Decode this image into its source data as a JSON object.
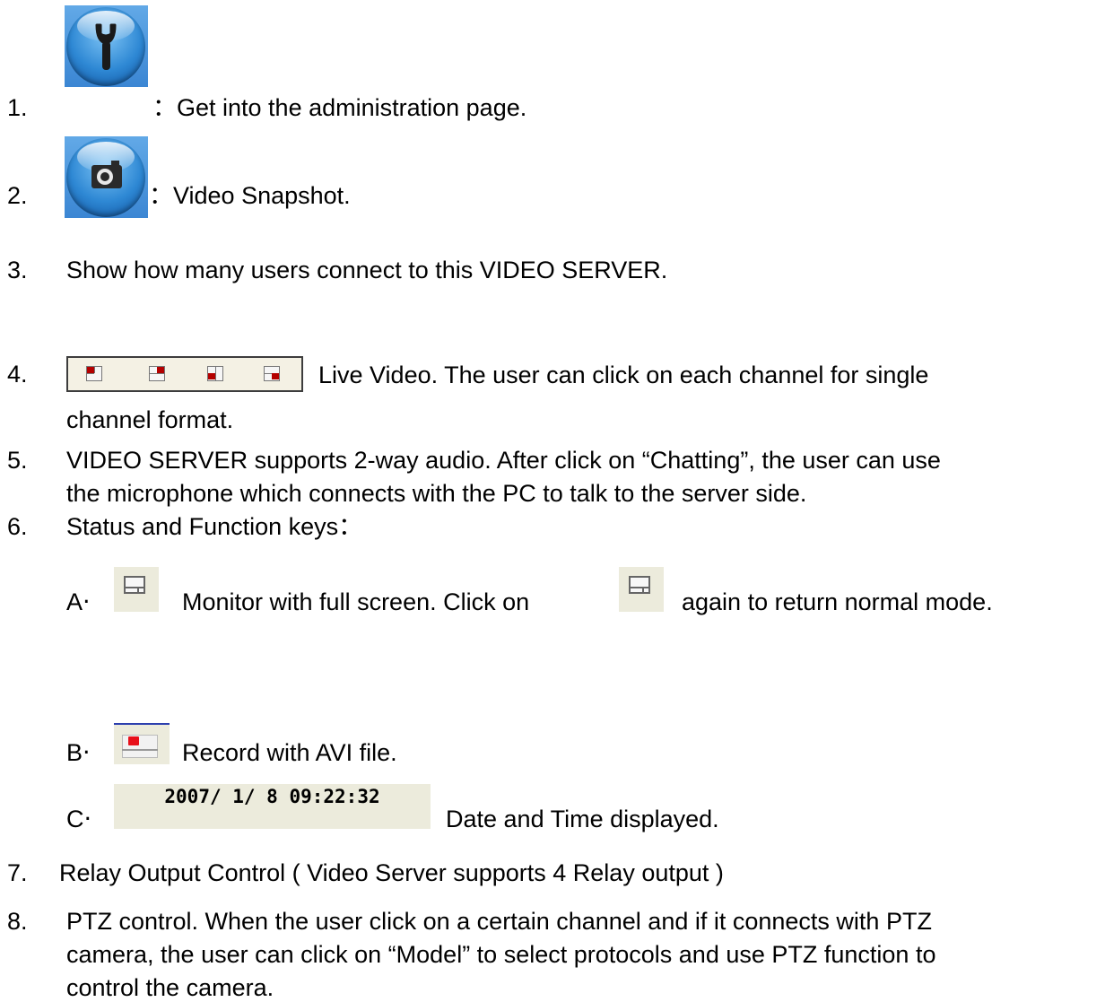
{
  "items": [
    {
      "num": "1.",
      "text": "：Get into the administration page.",
      "icon": "wrench-icon"
    },
    {
      "num": "2.",
      "text": "：Video Snapshot.",
      "icon": "camera-icon"
    },
    {
      "num": "3.",
      "text": "Show how many users connect to this VIDEO SERVER."
    },
    {
      "num": "4.",
      "text": "Live Video. The user can click on each channel for single",
      "text2": "channel format.",
      "icon": "split-view-icons"
    },
    {
      "num": "5.",
      "text": "VIDEO SERVER supports 2-way audio. After click on “Chatting”, the user can use",
      "text2": "the microphone which connects with the PC to talk to the server side."
    },
    {
      "num": "6.",
      "text": "Status and Function keys："
    },
    {
      "num": "7.",
      "text": "Relay Output Control ( Video Server supports 4 Relay output )"
    },
    {
      "num": "8.",
      "text": "PTZ control. When the user click on a certain channel and if it connects with PTZ",
      "text2": "camera, the user can click on “Model” to select protocols and use PTZ function to",
      "text3": "control the camera."
    }
  ],
  "sub_items": [
    {
      "letter": "A‧",
      "text": "Monitor with full screen. Click on",
      "text_after": "again to return normal mode.",
      "icon": "fullscreen-icon"
    },
    {
      "letter": "B‧",
      "text": "Record with AVI file.",
      "icon": "record-icon"
    },
    {
      "letter": "C‧",
      "text": "Date and Time displayed.",
      "datetime": "2007/ 1/ 8 09:22:32"
    }
  ],
  "colors": {
    "icon_blue": "#2e88d4",
    "icon_bg": "#ecebdc",
    "record_red": "#e8101a",
    "split_red": "#b40000"
  }
}
